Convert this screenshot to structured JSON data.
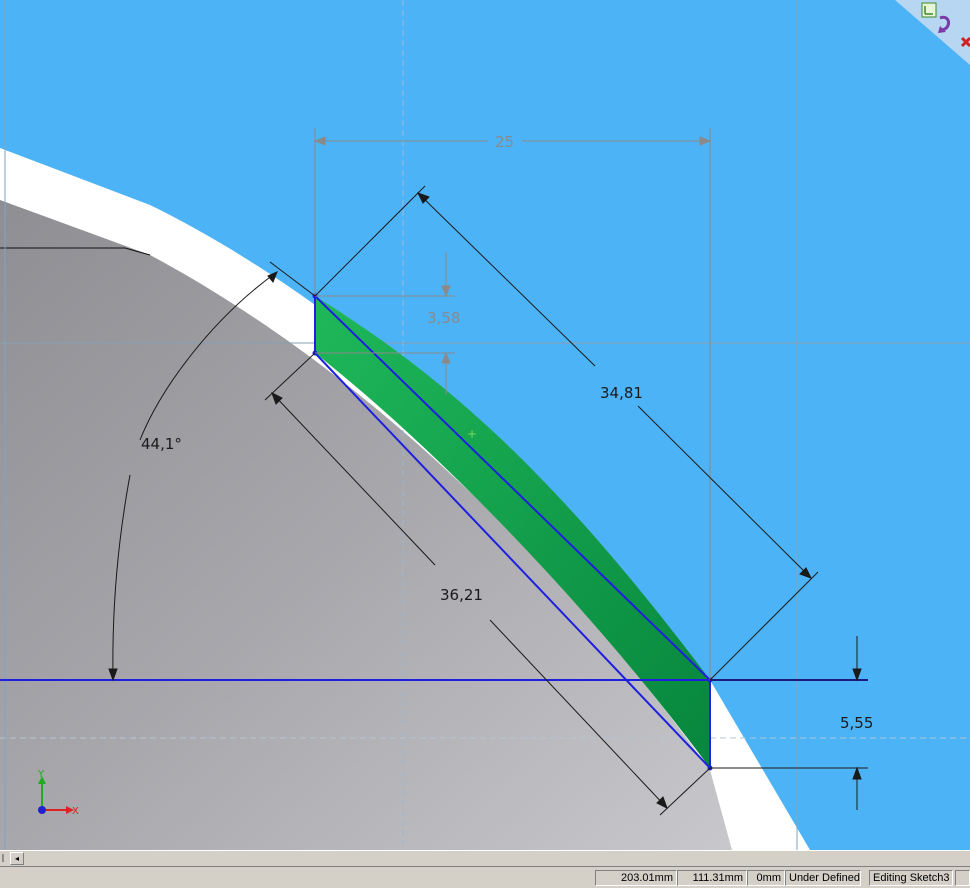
{
  "viewport": {
    "background_color": "#4db3f7",
    "part_face_color": "#a9a9ae",
    "highlight_face_color": "#16a651",
    "sketch_line_color": "#1f1fe0",
    "dimensions": {
      "horizontal_25": "25",
      "vertical_3_58": "3,58",
      "diagonal_34_81": "34,81",
      "diagonal_36_21": "36,21",
      "angle_44_1": "44,1°",
      "vertical_5_55": "5,55"
    },
    "triad": {
      "y_label": "Y",
      "x_label": "X"
    }
  },
  "corner_tray": {
    "icons": [
      "confirm-sketch-icon",
      "rebuild-icon",
      "cancel-sketch-icon"
    ]
  },
  "statusbar": {
    "x_coord": "203.01mm",
    "y_coord": "111.31mm",
    "z_coord": "0mm",
    "sketch_status": "Under Defined",
    "editing": "Editing Sketch3"
  },
  "scrollbar": {
    "left_arrow": "◂"
  }
}
